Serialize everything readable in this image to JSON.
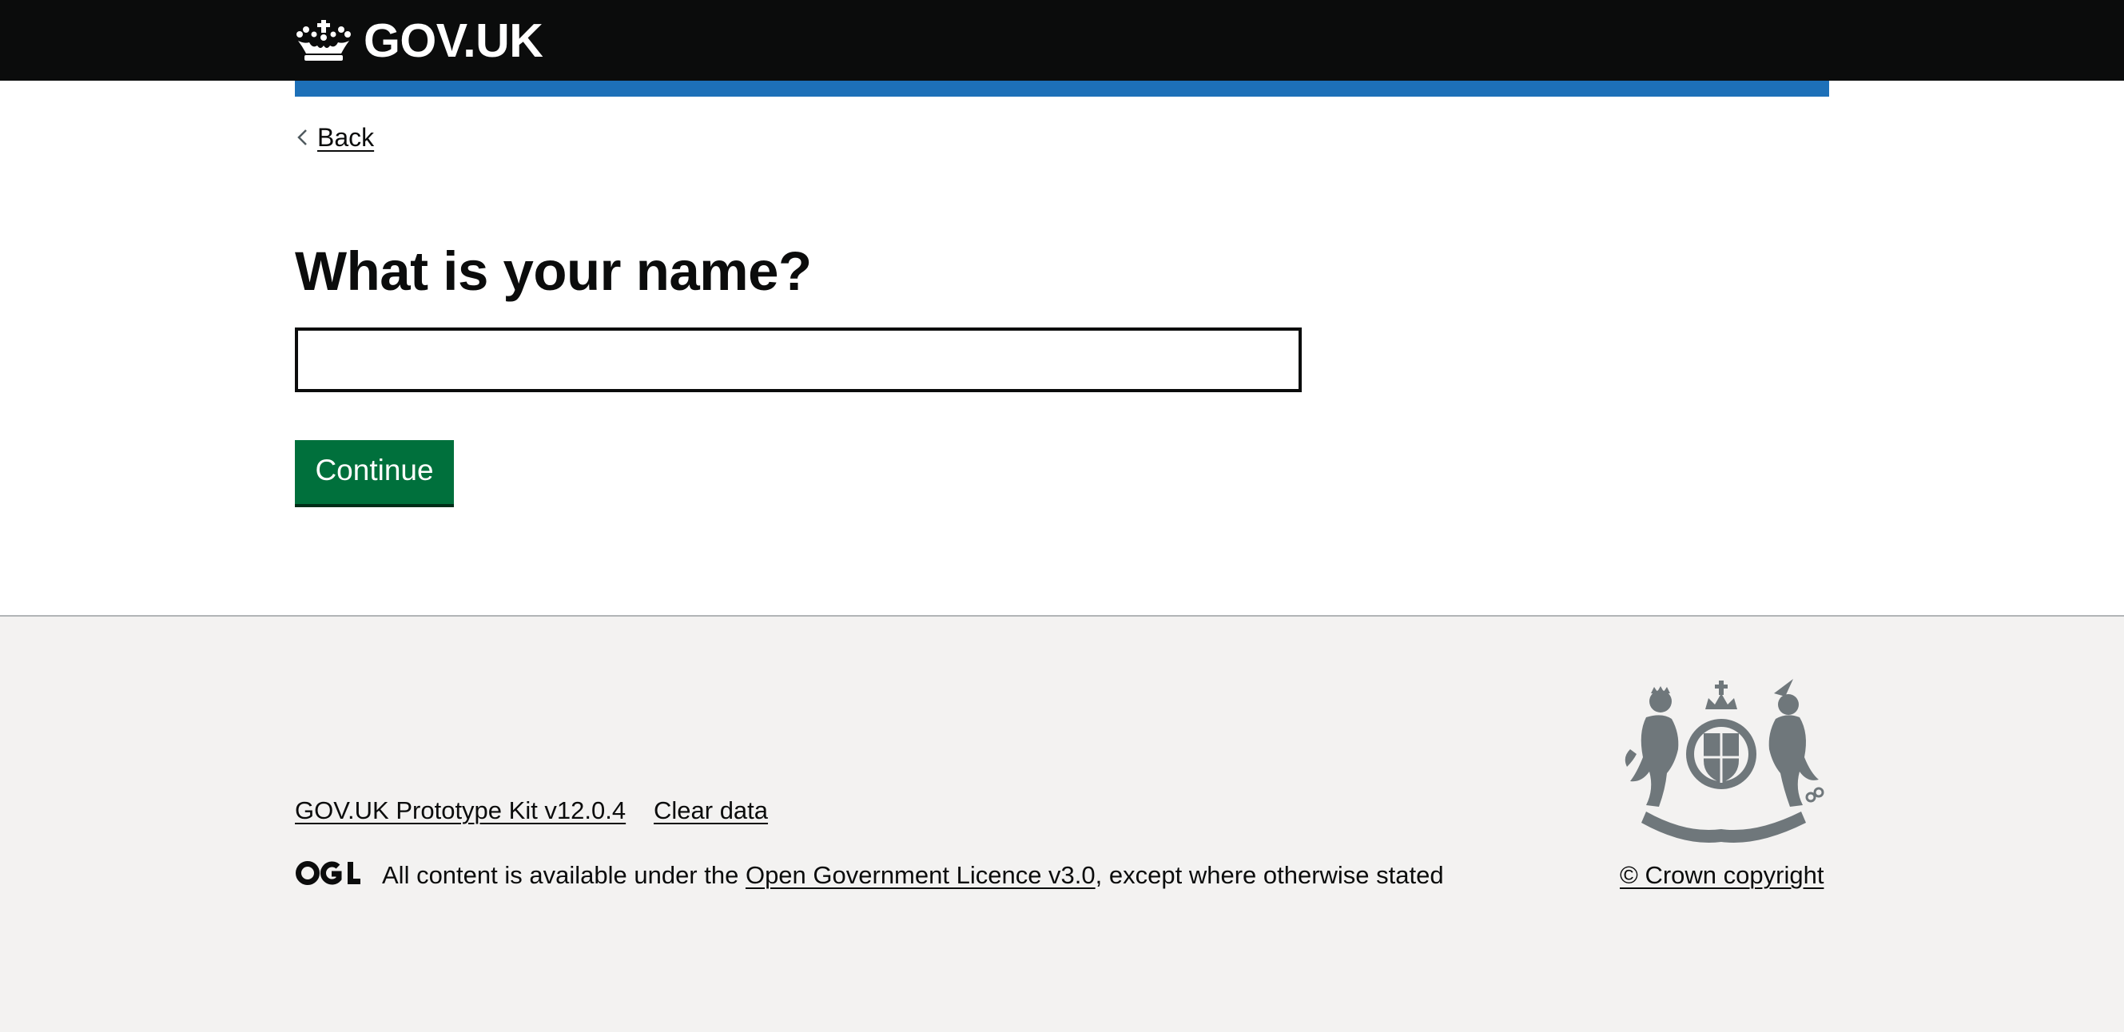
{
  "header": {
    "logo_text": "GOV.UK",
    "crown_icon": "crown-icon",
    "background_color": "#0b0c0c",
    "accent_bar_color": "#1d70b8"
  },
  "back_link": {
    "label": "Back",
    "icon": "chevron-left-icon"
  },
  "main": {
    "heading": "What is your name?",
    "name_input": {
      "value": "",
      "placeholder": ""
    },
    "continue_button": {
      "label": "Continue",
      "color": "#00703c"
    }
  },
  "footer": {
    "background_color": "#f3f2f1",
    "links": {
      "prototype_kit": "GOV.UK Prototype Kit v12.0.4",
      "clear_data": "Clear data"
    },
    "ogl_icon": "ogl-logo-icon",
    "licence": {
      "prefix": "All content is available under the ",
      "link": "Open Government Licence v3.0",
      "suffix": ", except where otherwise stated"
    },
    "crest_icon": "royal-coat-of-arms-icon",
    "copyright": "© Crown copyright"
  }
}
